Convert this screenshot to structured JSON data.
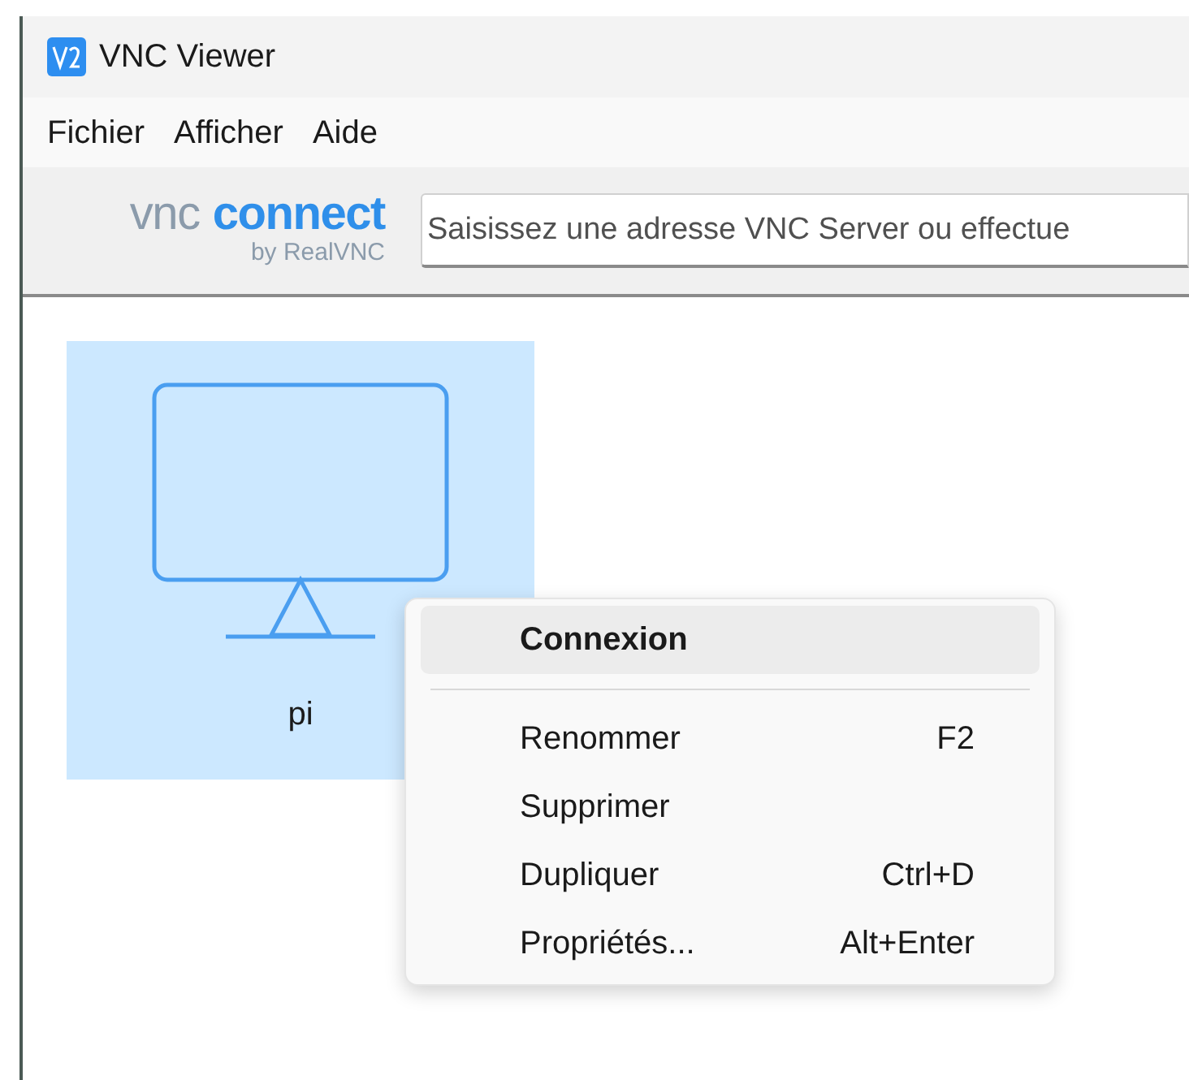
{
  "window": {
    "title": "VNC Viewer"
  },
  "menu_bar": [
    "Fichier",
    "Afficher",
    "Aide"
  ],
  "toolbar": {
    "logo": {
      "word_1": "vnc",
      "word_2": "connect",
      "tagline": "by RealVNC"
    },
    "address": {
      "placeholder": "Saisissez une adresse VNC Server ou effectue"
    }
  },
  "connections": [
    {
      "name": "pi",
      "selected": true
    }
  ],
  "context_menu": [
    {
      "kind": "item",
      "label": "Connexion",
      "default": true,
      "highlighted": true
    },
    {
      "kind": "separator"
    },
    {
      "kind": "item",
      "label": "Renommer",
      "shortcut": "F2",
      "default": false,
      "highlighted": false
    },
    {
      "kind": "item",
      "label": "Supprimer",
      "default": false,
      "highlighted": false
    },
    {
      "kind": "item",
      "label": "Dupliquer",
      "shortcut": "Ctrl+D",
      "default": false,
      "highlighted": false
    },
    {
      "kind": "item",
      "label": "Propriétés...",
      "shortcut": "Alt+Enter",
      "default": false,
      "highlighted": false
    }
  ]
}
